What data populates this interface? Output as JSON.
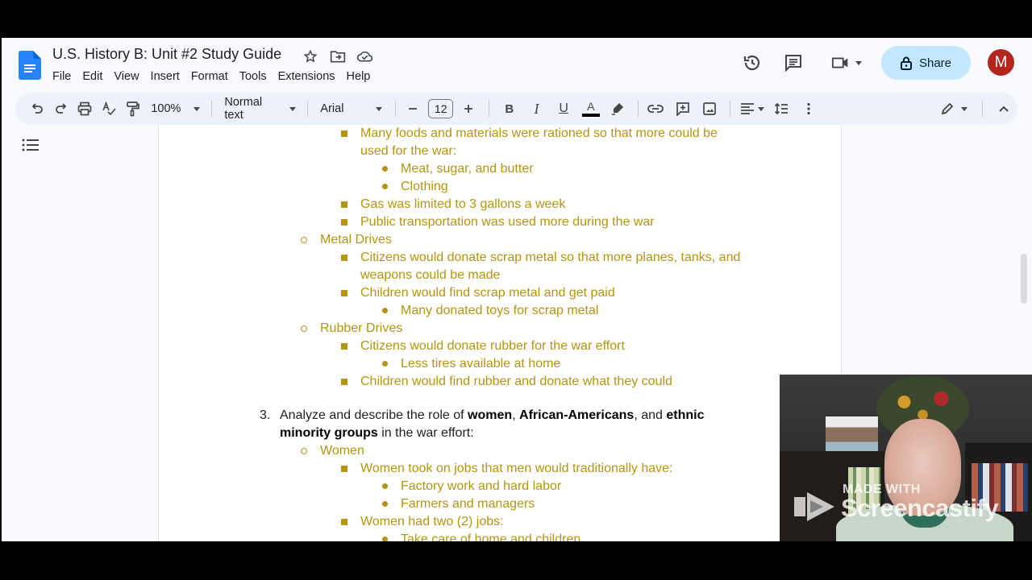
{
  "app": {
    "doc_title": "U.S. History B: Unit #2 Study Guide",
    "menu": [
      "File",
      "Edit",
      "View",
      "Insert",
      "Format",
      "Tools",
      "Extensions",
      "Help"
    ],
    "share_label": "Share",
    "avatar_initial": "M",
    "accent_color": "#c2e7ff",
    "avatar_color": "#b3261e"
  },
  "toolbar": {
    "zoom": "100%",
    "style": "Normal text",
    "font": "Arial",
    "font_size": "12",
    "bold": "B",
    "italic": "I",
    "underline": "U",
    "text_color": "A"
  },
  "document": {
    "text_color": "#b5940f",
    "lines": [
      {
        "level": 3,
        "marker": "square",
        "text": "Many foods and materials were rationed so that more could be"
      },
      {
        "level": 3,
        "marker": "none",
        "text": "used for the war:"
      },
      {
        "level": 4,
        "marker": "dot",
        "text": "Meat, sugar, and butter"
      },
      {
        "level": 4,
        "marker": "dot",
        "text": "Clothing"
      },
      {
        "level": 3,
        "marker": "square",
        "text": "Gas was limited to 3 gallons a week"
      },
      {
        "level": 3,
        "marker": "square",
        "text": "Public transportation was used more during the war"
      },
      {
        "level": 2,
        "marker": "ring",
        "text": "Metal Drives"
      },
      {
        "level": 3,
        "marker": "square",
        "text": "Citizens would donate scrap metal so that more planes, tanks, and"
      },
      {
        "level": 3,
        "marker": "none",
        "text": "weapons could be made"
      },
      {
        "level": 3,
        "marker": "square",
        "text": "Children would find scrap metal and get paid"
      },
      {
        "level": 4,
        "marker": "dot",
        "text": "Many donated toys for scrap metal"
      },
      {
        "level": 2,
        "marker": "ring",
        "text": "Rubber Drives"
      },
      {
        "level": 3,
        "marker": "square",
        "text": "Citizens would donate rubber for the war effort"
      },
      {
        "level": 4,
        "marker": "dot",
        "text": "Less tires available at home"
      },
      {
        "level": 3,
        "marker": "square",
        "text": "Children would find rubber and donate what they could"
      }
    ],
    "question": {
      "number": "3.",
      "line1": [
        {
          "text": "Analyze and describe the role of ",
          "bold": false
        },
        {
          "text": "women",
          "bold": true
        },
        {
          "text": ", ",
          "bold": false
        },
        {
          "text": "African-Americans",
          "bold": true
        },
        {
          "text": ", and ",
          "bold": false
        },
        {
          "text": "ethnic",
          "bold": true
        }
      ],
      "line2": [
        {
          "text": "minority groups",
          "bold": true
        },
        {
          "text": " in the war effort:",
          "bold": false
        }
      ]
    },
    "lines2": [
      {
        "level": 2,
        "marker": "ring",
        "text": "Women"
      },
      {
        "level": 3,
        "marker": "square",
        "text": "Women took on jobs that men would traditionally have:"
      },
      {
        "level": 4,
        "marker": "dot",
        "text": "Factory work and hard labor"
      },
      {
        "level": 4,
        "marker": "dot",
        "text": "Farmers and managers"
      },
      {
        "level": 3,
        "marker": "square",
        "text": "Women had two (2) jobs:"
      },
      {
        "level": 4,
        "marker": "dot",
        "text": "Take care of home and children"
      }
    ]
  },
  "overlay": {
    "watermark_small": "MADE WITH",
    "watermark_big": "Screencastify"
  }
}
